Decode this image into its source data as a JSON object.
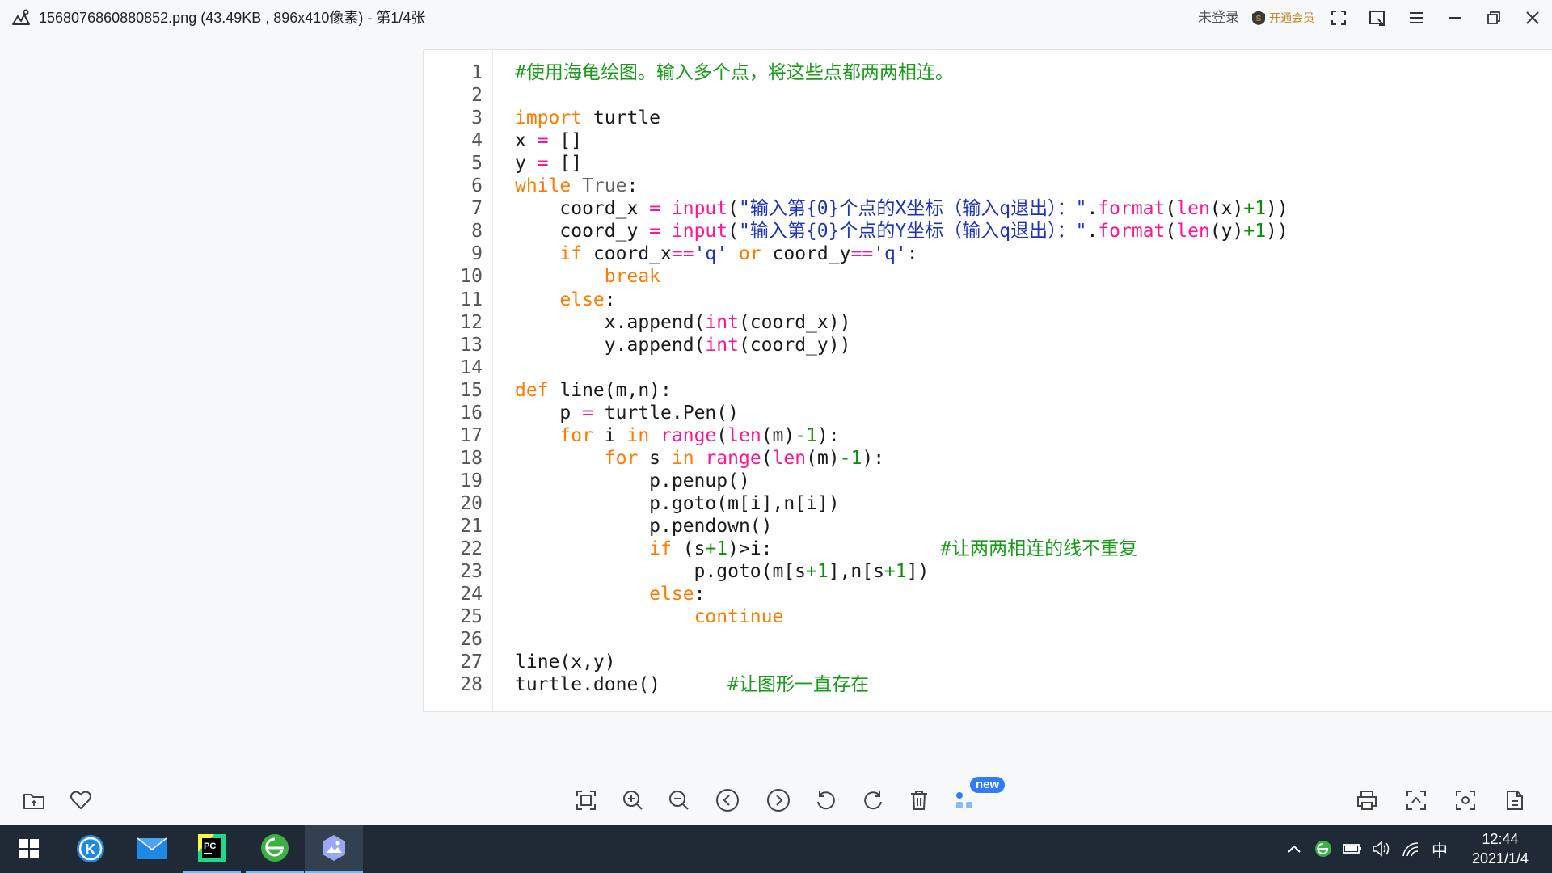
{
  "titlebar": {
    "title": "1568076860880852.png (43.49KB , 896x410像素) - 第1/4张",
    "login_label": "未登录",
    "vip_label": "开通会员"
  },
  "code": {
    "line_numbers": [
      "1",
      "2",
      "3",
      "4",
      "5",
      "6",
      "7",
      "8",
      "9",
      "10",
      "11",
      "12",
      "13",
      "14",
      "15",
      "16",
      "17",
      "18",
      "19",
      "20",
      "21",
      "22",
      "23",
      "24",
      "25",
      "26",
      "27",
      "28"
    ],
    "lines": [
      [
        {
          "t": "#使用海龟绘图。输入多个点，将这些点都两两相连。",
          "c": "cm"
        }
      ],
      [],
      [
        {
          "t": "import",
          "c": "kw"
        },
        {
          "t": " turtle",
          "c": ""
        }
      ],
      [
        {
          "t": "x ",
          "c": ""
        },
        {
          "t": "=",
          "c": "fn"
        },
        {
          "t": " []",
          "c": ""
        }
      ],
      [
        {
          "t": "y ",
          "c": ""
        },
        {
          "t": "=",
          "c": "fn"
        },
        {
          "t": " []",
          "c": ""
        }
      ],
      [
        {
          "t": "while",
          "c": "kw"
        },
        {
          "t": " True",
          "c": "cn"
        },
        {
          "t": ":",
          "c": ""
        }
      ],
      [
        {
          "t": "    coord_x ",
          "c": ""
        },
        {
          "t": "=",
          "c": "fn"
        },
        {
          "t": " ",
          "c": ""
        },
        {
          "t": "input",
          "c": "fn"
        },
        {
          "t": "(",
          "c": ""
        },
        {
          "t": "\"输入第{0}个点的X坐标（输入q退出）：\"",
          "c": "st"
        },
        {
          "t": ".",
          "c": ""
        },
        {
          "t": "format",
          "c": "fn"
        },
        {
          "t": "(",
          "c": ""
        },
        {
          "t": "len",
          "c": "fn"
        },
        {
          "t": "(x)",
          "c": ""
        },
        {
          "t": "+1",
          "c": "num"
        },
        {
          "t": "))",
          "c": ""
        }
      ],
      [
        {
          "t": "    coord_y ",
          "c": ""
        },
        {
          "t": "=",
          "c": "fn"
        },
        {
          "t": " ",
          "c": ""
        },
        {
          "t": "input",
          "c": "fn"
        },
        {
          "t": "(",
          "c": ""
        },
        {
          "t": "\"输入第{0}个点的Y坐标（输入q退出）：\"",
          "c": "st"
        },
        {
          "t": ".",
          "c": ""
        },
        {
          "t": "format",
          "c": "fn"
        },
        {
          "t": "(",
          "c": ""
        },
        {
          "t": "len",
          "c": "fn"
        },
        {
          "t": "(y)",
          "c": ""
        },
        {
          "t": "+1",
          "c": "num"
        },
        {
          "t": "))",
          "c": ""
        }
      ],
      [
        {
          "t": "    ",
          "c": ""
        },
        {
          "t": "if",
          "c": "kw"
        },
        {
          "t": " coord_x",
          "c": ""
        },
        {
          "t": "==",
          "c": "fn"
        },
        {
          "t": "'q'",
          "c": "st"
        },
        {
          "t": " ",
          "c": ""
        },
        {
          "t": "or",
          "c": "kw"
        },
        {
          "t": " coord_y",
          "c": ""
        },
        {
          "t": "==",
          "c": "fn"
        },
        {
          "t": "'q'",
          "c": "st"
        },
        {
          "t": ":",
          "c": ""
        }
      ],
      [
        {
          "t": "        ",
          "c": ""
        },
        {
          "t": "break",
          "c": "kw"
        }
      ],
      [
        {
          "t": "    ",
          "c": ""
        },
        {
          "t": "else",
          "c": "kw"
        },
        {
          "t": ":",
          "c": ""
        }
      ],
      [
        {
          "t": "        x.append(",
          "c": ""
        },
        {
          "t": "int",
          "c": "fn"
        },
        {
          "t": "(coord_x))",
          "c": ""
        }
      ],
      [
        {
          "t": "        y.append(",
          "c": ""
        },
        {
          "t": "int",
          "c": "fn"
        },
        {
          "t": "(coord_y))",
          "c": ""
        }
      ],
      [],
      [
        {
          "t": "def",
          "c": "kw"
        },
        {
          "t": " line(m,n):",
          "c": ""
        }
      ],
      [
        {
          "t": "    p ",
          "c": ""
        },
        {
          "t": "=",
          "c": "fn"
        },
        {
          "t": " turtle.Pen()",
          "c": ""
        }
      ],
      [
        {
          "t": "    ",
          "c": ""
        },
        {
          "t": "for",
          "c": "kw"
        },
        {
          "t": " i ",
          "c": ""
        },
        {
          "t": "in",
          "c": "kw"
        },
        {
          "t": " ",
          "c": ""
        },
        {
          "t": "range",
          "c": "fn"
        },
        {
          "t": "(",
          "c": ""
        },
        {
          "t": "len",
          "c": "fn"
        },
        {
          "t": "(m)",
          "c": ""
        },
        {
          "t": "-1",
          "c": "num"
        },
        {
          "t": "):",
          "c": ""
        }
      ],
      [
        {
          "t": "        ",
          "c": ""
        },
        {
          "t": "for",
          "c": "kw"
        },
        {
          "t": " s ",
          "c": ""
        },
        {
          "t": "in",
          "c": "kw"
        },
        {
          "t": " ",
          "c": ""
        },
        {
          "t": "range",
          "c": "fn"
        },
        {
          "t": "(",
          "c": ""
        },
        {
          "t": "len",
          "c": "fn"
        },
        {
          "t": "(m)",
          "c": ""
        },
        {
          "t": "-1",
          "c": "num"
        },
        {
          "t": "):",
          "c": ""
        }
      ],
      [
        {
          "t": "            p.penup()",
          "c": ""
        }
      ],
      [
        {
          "t": "            p.goto(m[i],n[i])",
          "c": ""
        }
      ],
      [
        {
          "t": "            p.pendown()",
          "c": ""
        }
      ],
      [
        {
          "t": "            ",
          "c": ""
        },
        {
          "t": "if",
          "c": "kw"
        },
        {
          "t": " (s",
          "c": ""
        },
        {
          "t": "+1",
          "c": "num"
        },
        {
          "t": ")>i:               ",
          "c": ""
        },
        {
          "t": "#让两两相连的线不重复",
          "c": "cm"
        }
      ],
      [
        {
          "t": "                p.goto(m[s",
          "c": ""
        },
        {
          "t": "+1",
          "c": "num"
        },
        {
          "t": "],n[s",
          "c": ""
        },
        {
          "t": "+1",
          "c": "num"
        },
        {
          "t": "])",
          "c": ""
        }
      ],
      [
        {
          "t": "            ",
          "c": ""
        },
        {
          "t": "else",
          "c": "kw"
        },
        {
          "t": ":",
          "c": ""
        }
      ],
      [
        {
          "t": "                ",
          "c": ""
        },
        {
          "t": "continue",
          "c": "kw"
        }
      ],
      [],
      [
        {
          "t": "line(x,y)",
          "c": ""
        }
      ],
      [
        {
          "t": "turtle.done()      ",
          "c": ""
        },
        {
          "t": "#让图形一直存在",
          "c": "cm"
        }
      ]
    ]
  },
  "toolbar": {
    "new_badge": "new"
  },
  "clock": {
    "time": "12:44",
    "date": "2021/1/4"
  },
  "tray": {
    "ime": "中"
  }
}
